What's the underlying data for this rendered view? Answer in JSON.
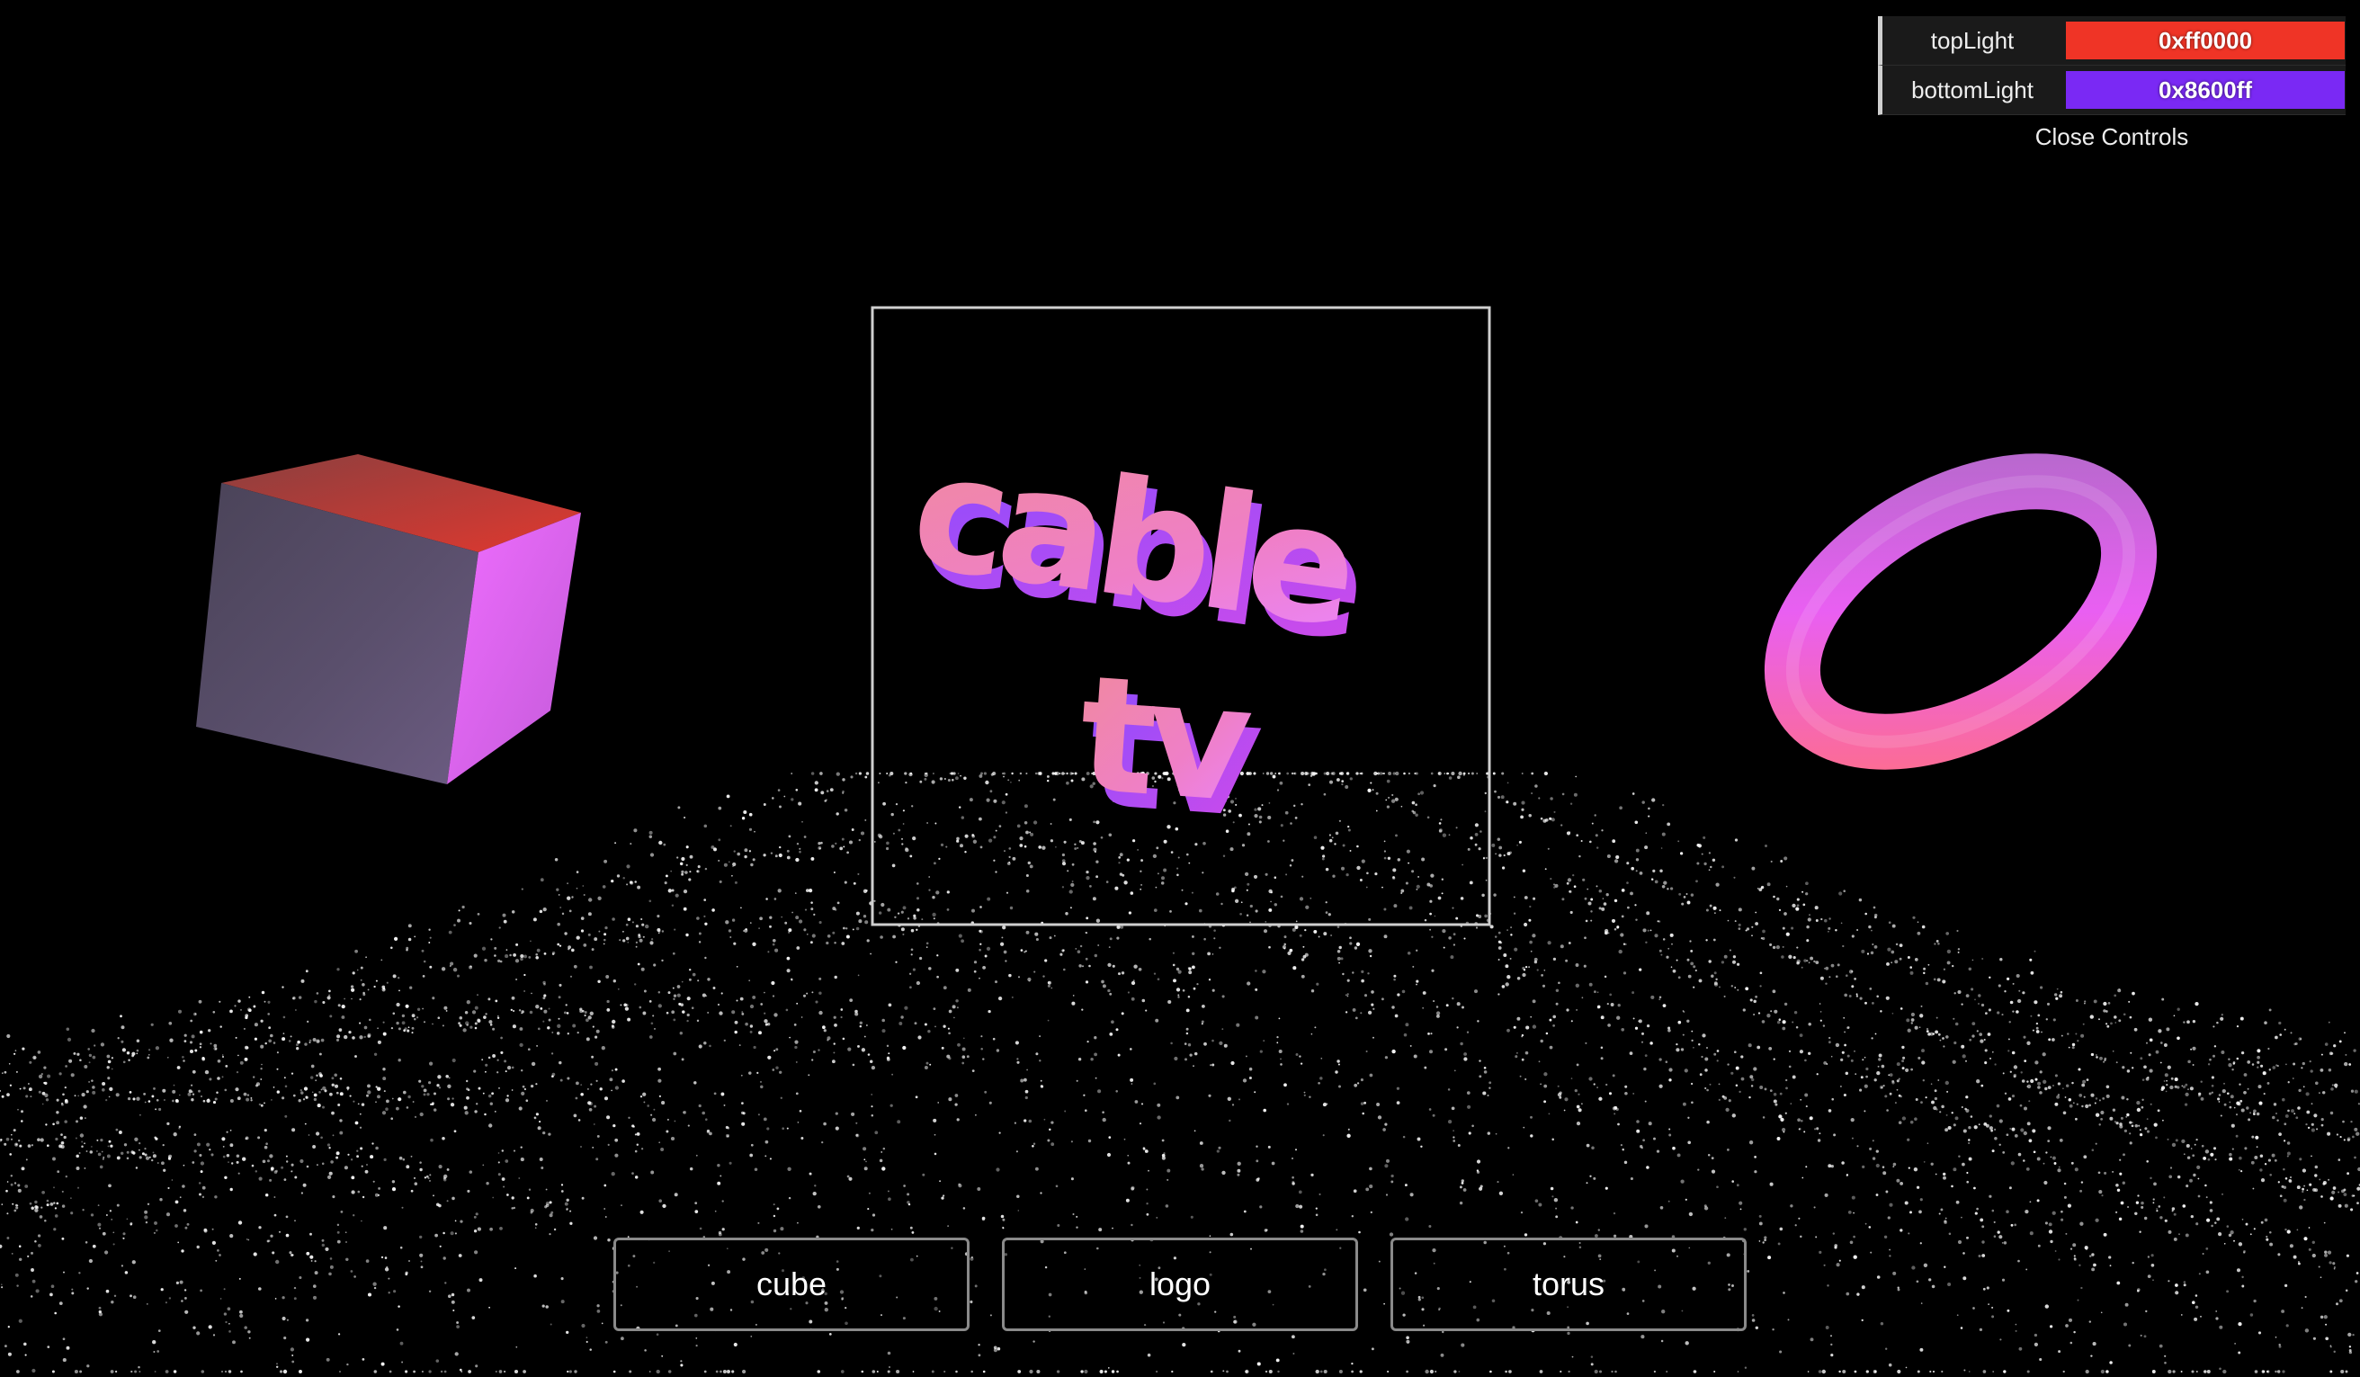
{
  "controls": {
    "rows": [
      {
        "label": "topLight",
        "value": "0xff0000",
        "color": "#ef3426"
      },
      {
        "label": "bottomLight",
        "value": "0x8600ff",
        "color": "#7a29f4"
      }
    ],
    "close_label": "Close Controls"
  },
  "scene": {
    "logo_text": [
      "cable",
      "tv"
    ],
    "icons": [
      "cube-icon",
      "logo-icon",
      "torus-icon"
    ]
  },
  "nav": {
    "cube": "cube",
    "logo": "logo",
    "torus": "torus"
  }
}
